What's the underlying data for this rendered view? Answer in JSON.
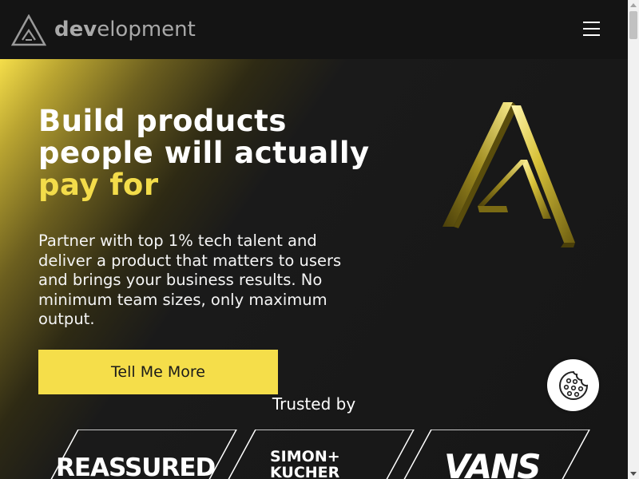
{
  "header": {
    "logo_icon": "triangle-a-logo-icon",
    "logo_bold": "dev",
    "logo_rest": "elopment",
    "menu_icon": "hamburger-menu-icon"
  },
  "hero": {
    "title_line1": "Build products",
    "title_line2": "people will actually",
    "title_accent": "pay for",
    "subtitle": "Partner with top 1% tech talent and deliver a product that matters to users and brings your business results. No minimum team sizes, only maximum output.",
    "cta_label": "Tell Me More",
    "mark_icon": "golden-triangle-a-icon"
  },
  "trusted": {
    "heading": "Trusted by",
    "brands": [
      "REASSURED",
      "SIMON+\nKUCHER",
      "VANS"
    ]
  },
  "cookie": {
    "icon": "cookie-icon"
  },
  "colors": {
    "accent": "#f5de4a",
    "background": "#161616",
    "header_bg": "#141414"
  }
}
